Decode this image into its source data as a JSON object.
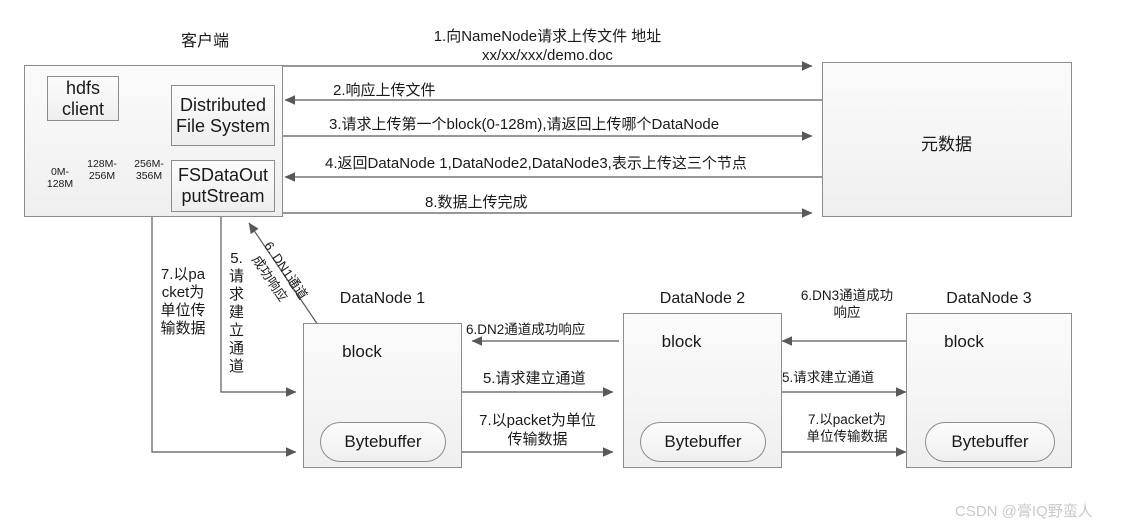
{
  "diagram": {
    "title_client": "客户端",
    "client": {
      "hdfs_client": "hdfs\nclient",
      "hdfs_client_line1": "hdfs",
      "hdfs_client_line2": "client",
      "dfs_line1": "Distributed",
      "dfs_line2": "File System",
      "fsdos_line1": "FSDataOut",
      "fsdos_line2": "putStream",
      "file_segments": [
        {
          "line1": "0M-",
          "line2": "128M"
        },
        {
          "line1": "128M-",
          "line2": "256M"
        },
        {
          "line1": "256M-",
          "line2": "356M"
        }
      ]
    },
    "namenode": {
      "metadata_label": "元数据"
    },
    "messages": [
      {
        "id": "msg-1",
        "line1": "1.向NameNode请求上传文件 地址",
        "line2": "xx/xx/xxx/demo.doc",
        "direction": "right"
      },
      {
        "id": "msg-2",
        "line1": "2.响应上传文件",
        "line2": "",
        "direction": "left"
      },
      {
        "id": "msg-3",
        "line1": "3.请求上传第一个block(0-128m),请返回上传哪个DataNode",
        "line2": "",
        "direction": "right"
      },
      {
        "id": "msg-4",
        "line1": "4.返回DataNode 1,DataNode2,DataNode3,表示上传这三个节点",
        "line2": "",
        "direction": "left"
      },
      {
        "id": "msg-8",
        "line1": "8.数据上传完成",
        "line2": "",
        "direction": "right"
      }
    ],
    "datanodes": [
      {
        "title": "DataNode 1",
        "block_label": "block",
        "buffer_label": "Bytebuffer"
      },
      {
        "title": "DataNode 2",
        "block_label": "block",
        "buffer_label": "Bytebuffer"
      },
      {
        "title": "DataNode 3",
        "block_label": "block",
        "buffer_label": "Bytebuffer"
      }
    ],
    "client_to_dn_labels": {
      "packet_vertical": "7.以packet为单位传输数据",
      "channel_vertical": "5.请求建立通道",
      "dn1_ack_rot_line1": "6. DN1通道",
      "dn1_ack_rot_line2": "成功响应"
    },
    "dn1_dn2_labels": {
      "ack": "6.DN2通道成功响应",
      "request": "5.请求建立通道",
      "packet_line1": "7.以packet为单位",
      "packet_line2": "传输数据"
    },
    "dn2_dn3_labels": {
      "ack_line1": "6.DN3通道成功",
      "ack_line2": "响应",
      "request": "5.请求建立通道",
      "packet_line1": "7.以packet为",
      "packet_line2": "单位传输数据"
    },
    "watermark": "CSDN @膏IQ野蛮人",
    "colors": {
      "line": "#595959",
      "border": "#8c8c8c",
      "blue_bar": "#5b8fc9",
      "watermark": "#c9c9c9"
    }
  }
}
